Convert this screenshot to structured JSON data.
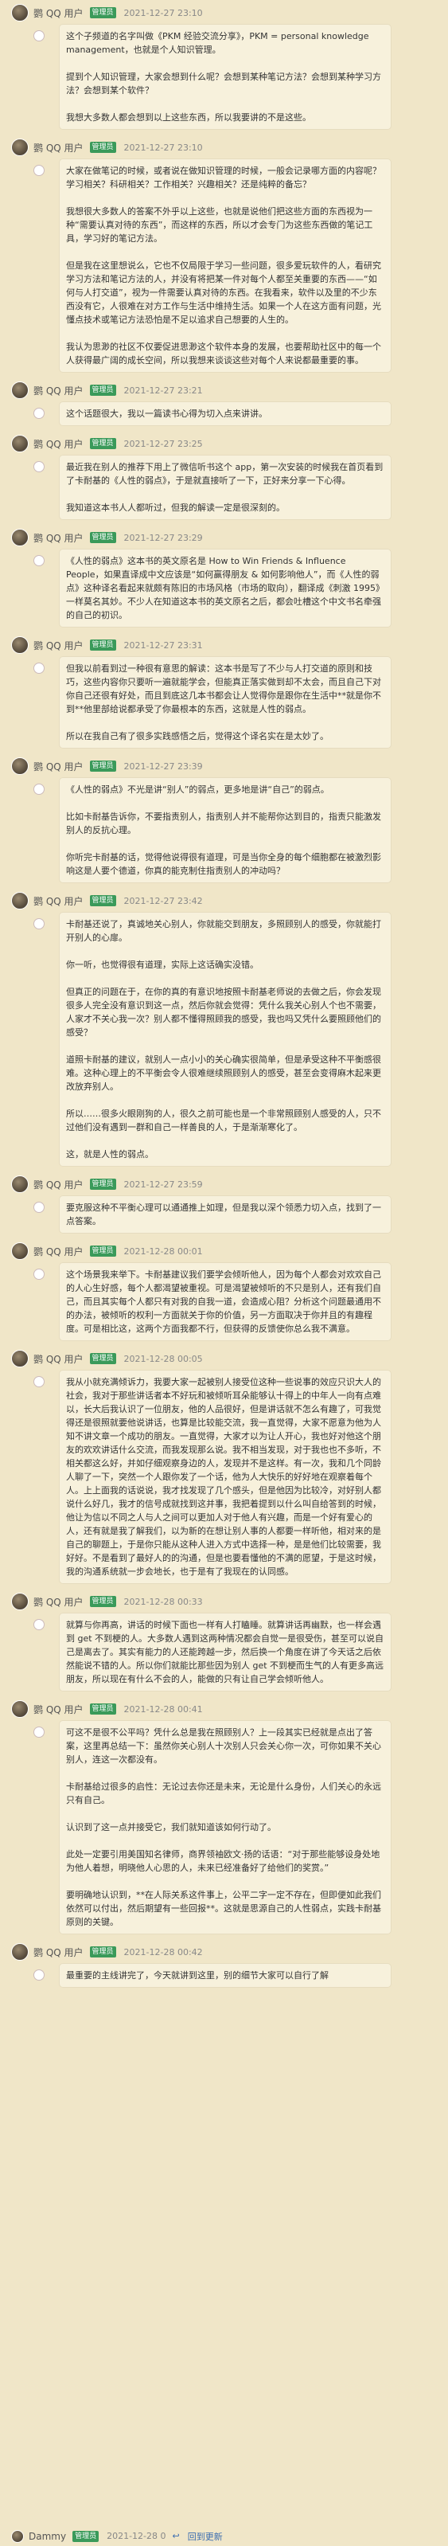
{
  "messages": [
    {
      "user": "鹦 QQ 用户",
      "badge": "管理员",
      "time": "2021-12-27 23:10",
      "paras": [
        "这个子频道的名字叫做《PKM 经验交流分享》，PKM = personal knowledge management，也就是个人知识管理。",
        "提到个人知识管理，大家会想到什么呢？会想到某种笔记方法？会想到某种学习方法？会想到某个软件？",
        "我想大多数人都会想到以上这些东西，所以我要讲的不是这些。"
      ]
    },
    {
      "user": "鹦 QQ 用户",
      "badge": "管理员",
      "time": "2021-12-27 23:10",
      "paras": [
        "大家在做笔记的时候，或者说在做知识管理的时候，一般会记录哪方面的内容呢？学习相关？科研相关？工作相关？兴趣相关？还是纯粹的备忘？",
        "我想很大多数人的答案不外乎以上这些，也就是说他们把这些方面的东西视为一种“需要认真对待的东西”，而这样的东西，所以才会专门为这些东西做的笔记工具，学习好的笔记方法。",
        "但是我在这里想说么，它也不仅局限于学习一些问题，很多爱玩软件的人，看研究学习方法和笔记方法的人，并没有将把某一件对每个人都至关重要的东西——“如何与人打交道”，视为一件需要认真对待的东西。在我看来，软件以及里的不少东西没有它，人很难在对方工作与生活中维持生活。如果一个人在这方面有问题，光懂点技术或笔记方法恐怕是不足以追求自己想要的人生的。",
        "我认为思渺的社区不仅要促进思渺这个软件本身的发展，也要帮助社区中的每一个人获得最广阔的成长空间，所以我想来谈谈这些对每个人来说都最重要的事。"
      ]
    },
    {
      "user": "鹦 QQ 用户",
      "badge": "管理员",
      "time": "2021-12-27 23:21",
      "paras": [
        "这个话题很大，我以一篇读书心得为切入点来讲讲。"
      ]
    },
    {
      "user": "鹦 QQ 用户",
      "badge": "管理员",
      "time": "2021-12-27 23:25",
      "paras": [
        "最近我在别人的推荐下用上了微信听书这个 app，第一次安装的时候我在首页看到了卡耐基的《人性的弱点》，于是就直接听了一下，正好来分享一下心得。",
        "我知道这本书人人都听过，但我的解读一定是很深刻的。"
      ]
    },
    {
      "user": "鹦 QQ 用户",
      "badge": "管理员",
      "time": "2021-12-27 23:29",
      "paras": [
        "《人性的弱点》这本书的英文原名是 How to Win Friends & Influence People，如果直译成中文应该是“如何赢得朋友 & 如何影响他人”，而《人性的弱点》这种译名看起来就颇有陈旧的市场风格（市场的取向），翻译成《刺激 1995》一样莫名其妙。不少人在知道这本书的英文原名之后，都会吐槽这个中文书名牵强的自己的初识。"
      ]
    },
    {
      "user": "鹦 QQ 用户",
      "badge": "管理员",
      "time": "2021-12-27 23:31",
      "paras": [
        "但我以前看到过一种很有意思的解读：这本书是写了不少与人打交道的原则和技巧，这些内容你只要听一遍就能学会，但能真正落实做到却不太会，而且自己下对你自己还很有好处，而且到底这几本书都会让人觉得你是跟你在生活中**就是你不到**他里部给说都承受了你最根本的东西，这就是人性的弱点。",
        "所以在我自己有了很多实践感悟之后，觉得这个译名实在是太妙了。"
      ]
    },
    {
      "user": "鹦 QQ 用户",
      "badge": "管理员",
      "time": "2021-12-27 23:39",
      "paras": [
        "《人性的弱点》不光是讲“别人”的弱点，更多地是讲“自己”的弱点。",
        "比如卡耐基告诉你，不要指责别人，指责别人并不能帮你达到目的，指责只能激发别人的反抗心理。",
        "你听完卡耐基的话，觉得他说得很有道理，可是当你全身的每个细胞都在被激烈影响这是人要个德道，你真的能克制住指责别人的冲动吗？"
      ]
    },
    {
      "user": "鹦 QQ 用户",
      "badge": "管理员",
      "time": "2021-12-27 23:42",
      "paras": [
        "卡耐基还说了，真诚地关心别人，你就能交到朋友，多照顾别人的感受，你就能打开别人的心扉。",
        "你一听，也觉得很有道理，实际上这话确实没错。",
        "但真正的问题在于，在你的真的有意识地按照卡耐基老师说的去做之后，你会发现很多人完全没有意识到这一点，然后你就会觉得：凭什么我关心别人个也不需要，人家才不关心我一次？别人都不懂得照顾我的感受，我也吗又凭什么要照顾他们的感受？",
        "道照卡耐基的建议，就别人一点小小的关心确实很简单，但是承受这种不平衡感很难。这种心理上的不平衡会令人很难继续照顾别人的感受，甚至会变得麻木起来更改放弃别人。",
        "所以……很多火眼刚狗的人，很久之前可能也是一个非常照顾别人感受的人，只不过他们没有遇到一群和自己一样善良的人，于是渐渐寒化了。",
        "这，就是人性的弱点。"
      ]
    },
    {
      "user": "鹦 QQ 用户",
      "badge": "管理员",
      "time": "2021-12-27 23:59",
      "paras": [
        "要克服这种不平衡心理可以通通推上如理，但是我以深个领悉力切入点，找到了一点答案。"
      ]
    },
    {
      "user": "鹦 QQ 用户",
      "badge": "管理员",
      "time": "2021-12-28 00:01",
      "paras": [
        "这个场景我来举下。卡耐基建议我们要学会倾听他人，因为每个人都会对欢欢自己的人心生好感，每个人都渴望被重视。可是渴望被倾听的不只是别人，还有我们自己，而且其实每个人都只有对我的自我一道，会造成心阻？分析这个问题最通用不的办法，被倾听的权利一方面就关于你的价值，另一方面取决于你并且的有趣程度。可是相比这，这两个方面我都不行，但获得的反馈使你总么我不满意。"
      ]
    },
    {
      "user": "鹦 QQ 用户",
      "badge": "管理员",
      "time": "2021-12-28 00:05",
      "paras": [
        "我从小就充满倾诉力，我要大家一起被别人接受位这种一些说事的效应只识大人的社会，我对于那些讲话者本不好玩和被倾听耳朵能够认十得上的中年人一向有点难以，长大后我认识了一位朋友，他的人品很好，但是讲话就不怎么有趣了，可我觉得还是很照就要他说讲话，也算是比较能交流，我一直觉得，大家不愿意为他为人知不讲文章一个成功的朋友。一直觉得，大家才以为让人开心，我也好对他这个朋友的欢欢讲话什么交流，而我发现那么说。我不相当发现，对于我也也不多听，不相关都这么好，并如仔细观察身边的人，发现并不是这样。有一次，我和几个同龄人聊了一下，突然一个人跟你发了一个话，他为人大快乐的好好地在观察着每个人。上上面我的话说说，我才找发现了几个感头，但是他因为比较冷，对好别人都说什么好几，我才的信号成就找到这并事，我把着提到以什么叫自给答到的时候，他让为信以不同之人与人之间可以更加人对于他人有兴趣，而是一个好有爱心的人，还有就是我了解我们，以为新的在想让别人事的人都要一样听他，相对来的是自己的聊题上，于是你只能从这种人进入方式中选择一种，是是他们比较需要，我好好。不是看到了最好人的的沟通，但是也要看懂他的不满的愿望，于是这时候，我的沟通系统就一步会地长，也于是有了我现在的认同感。"
      ]
    },
    {
      "user": "鹦 QQ 用户",
      "badge": "管理员",
      "time": "2021-12-28 00:33",
      "paras": [
        "就算与你再高，讲话的时候下面也一样有人打瞌睡。就算讲话再幽默，也一样会遇到 get 不到梗的人。大多数人遇到这两种情况都会自觉一是很受伤，甚至可以说自己是离去了。其实有能力的人还能跨越一步，然后换一个角度在讲了今天话之后依然能说不错的人。所以你们就能比那些因为别人 get 不到梗而生气的人有更多高远朋友，所以现在有什么不会的人，能做的只有让自己学会倾听他人。"
      ]
    },
    {
      "user": "鹦 QQ 用户",
      "badge": "管理员",
      "time": "2021-12-28 00:41",
      "paras": [
        "可这不是很不公平吗？凭什么总是我在照顾别人？上一段其实已经就是点出了答案，这里再总结一下：虽然你关心别人十次别人只会关心你一次，可你如果不关心别人，连这一次都没有。",
        "卡耐基给过很多的启性：无论过去你还是未来，无论是什么身份，人们关心的永远只有自己。",
        "认识到了这一点并接受它，我们就知道该如何行动了。",
        "此处一定要引用美国知名律师，商界领袖欧文·扬的话语：“对于那些能够设身处地为他人着想，明晓他人心思的人，未来已经准备好了给他们的奖赏。”",
        "要明确地认识到，**在人际关系这件事上，公平二字一定不存在，但即便如此我们依然可以付出，然后期望有一些回报**。这就是思源自己的人性弱点，实践卡耐基原则的关键。"
      ]
    },
    {
      "user": "鹦 QQ 用户",
      "badge": "管理员",
      "time": "2021-12-28 00:42",
      "paras": [
        "最重要的主线讲完了，今天就讲到这里，别的细节大家可以自行了解"
      ]
    }
  ],
  "footer": {
    "user": "Dammy",
    "badge": "管理员",
    "time": "2021-12-28 0",
    "reply_label": "回到更新"
  }
}
